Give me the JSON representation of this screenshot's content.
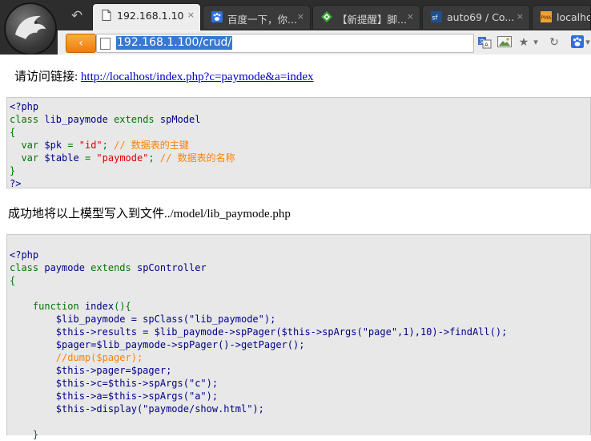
{
  "browser": {
    "tabs": [
      {
        "label": "192.168.1.10",
        "icon": "document-icon",
        "active": true
      },
      {
        "label": "百度一下，你...",
        "icon": "baidu-paw-icon",
        "active": false
      },
      {
        "label": "【新提醒】脚...",
        "icon": "diamond-icon",
        "active": false
      },
      {
        "label": "auto69 / Co...",
        "icon": "sf-icon",
        "active": false
      },
      {
        "label": "localhos",
        "icon": "pma-icon",
        "active": false
      }
    ],
    "close_glyph": "×",
    "back_glyph": "↶",
    "nav_back_glyph": "‹",
    "url": "192.168.1.100/crud/",
    "toolbar_icons": [
      "translate-icon",
      "image-icon",
      "star-icon",
      "dropdown-icon",
      "reload-icon",
      "baidu-paw-icon"
    ],
    "toolbar_glyphs": {
      "star": "★",
      "dropdown": "▾",
      "reload": "↻"
    },
    "accent": "#ee7b0f"
  },
  "page": {
    "visit_prefix": "请访问链接:",
    "visit_link": "http://localhost/index.php?c=paymode&a=index",
    "success_message": "成功地将以上模型写入到文件../model/lib_paymode.php",
    "code_block_1": {
      "php_open": "<?php",
      "class_kw": "class",
      "class_name": "lib_paymode",
      "extends_kw": "extends",
      "parent": "spModel",
      "brace_open": "{",
      "line_pk": {
        "kw": "var",
        "var": "$pk",
        "eq": " = ",
        "str": "\"id\"",
        "semi": ";",
        "comment": "// 数据表的主键"
      },
      "line_table": {
        "kw": "var",
        "var": "$table",
        "eq": " = ",
        "str": "\"paymode\"",
        "semi": ";",
        "comment": "// 数据表的名称"
      },
      "brace_close": "}",
      "php_close": "?>"
    },
    "code_block_2": {
      "php_open": "<?php",
      "class_kw": "class",
      "class_name": "paymode",
      "extends_kw": "extends",
      "parent": "spController",
      "brace_open": "{",
      "func_kw": "function",
      "func_name": "index",
      "func_sig": "(){",
      "lines": [
        "$lib_paymode = spClass(\"lib_paymode\");",
        "$this->results = $lib_paymode->spPager($this->spArgs(\"page\",1),10)->findAll();",
        "$pager=$lib_paymode->spPager()->getPager();",
        "//dump($pager);",
        "$this->pager=$pager;",
        "$this->c=$this->spArgs(\"c\");",
        "$this->a=$this->spArgs(\"a\");",
        "$this->display(\"paymode/show.html\");"
      ],
      "func_close": "}"
    }
  }
}
